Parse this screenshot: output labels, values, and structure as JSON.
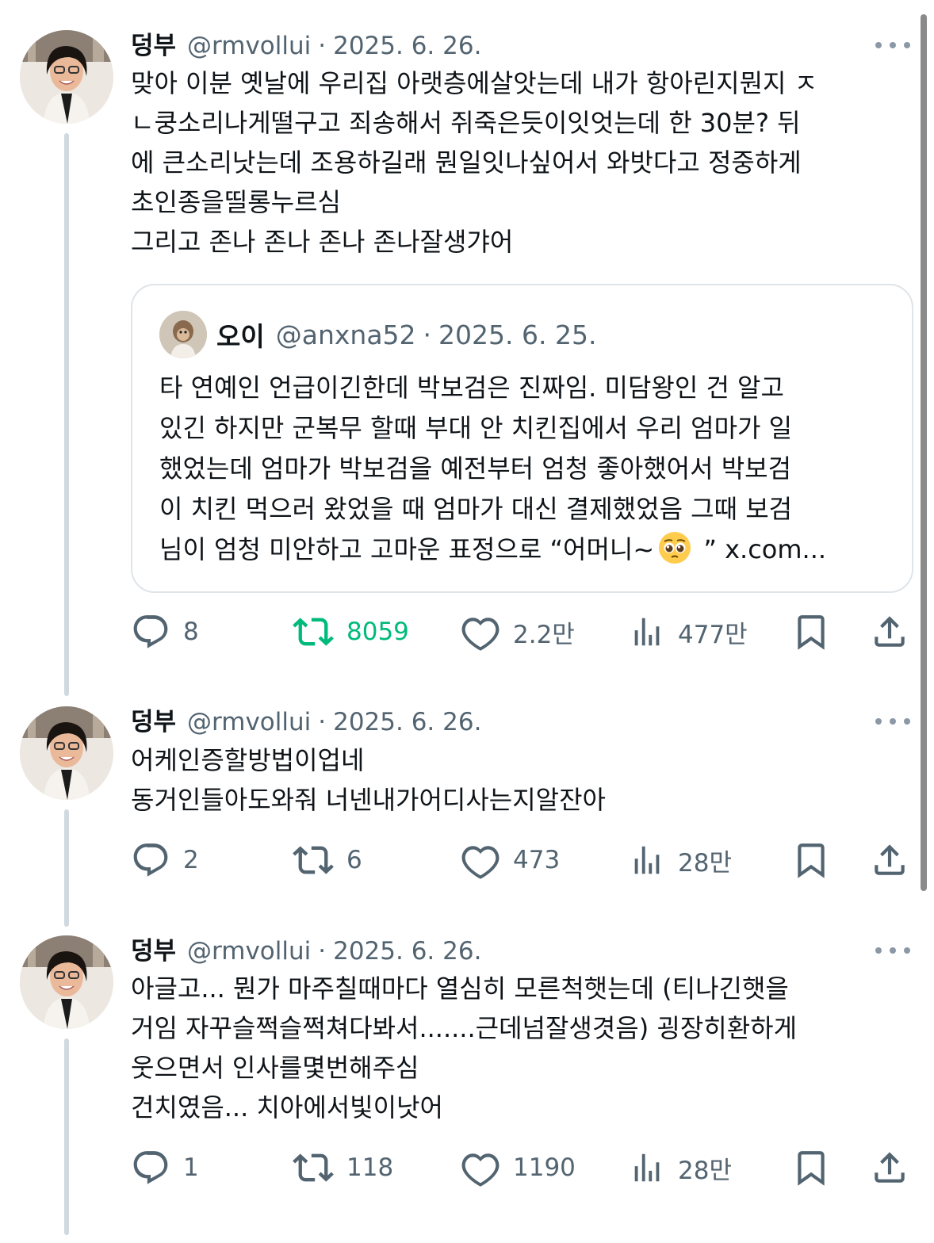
{
  "scrollbar": {
    "color": "#8a8a8a"
  },
  "colors": {
    "retweet_active": "#00ba7c",
    "muted": "#536471",
    "text": "#0f1419"
  },
  "tweets": [
    {
      "name": "덩부",
      "handle": "@rmvollui",
      "separator": "·",
      "date": "2025. 6. 26.",
      "more_icon": "more-dots-icon",
      "lines": [
        "맞아 이분 옛날에 우리집 아랫층에살앗는데 내가 항아린지뭔지 ㅈ",
        "ㄴ쿵소리나게떨구고 죄송해서 쥐죽은듯이잇엇는데 한 30분? 뒤",
        "에 큰소리낫는데 조용하길래 뭔일잇나싶어서 와밧다고 정중하게",
        "초인종을띨롱누르심",
        "그리고 존나 존나 존나 존나잘생갸어"
      ],
      "quote": {
        "name": "오이",
        "handle": "@anxna52",
        "separator": "·",
        "date": "2025. 6. 25.",
        "lines": [
          "타 연예인 언급이긴한데 박보검은 진짜임. 미담왕인 건 알고",
          "있긴 하지만 군복무 할때 부대 안 치킨집에서 우리 엄마가 일",
          "했었는데 엄마가 박보검을 예전부터 엄청 좋아했어서 박보검",
          "이 치킨 먹으러 왔었을 때 엄마가 대신 결제했었음 그때 보검"
        ],
        "last_line_pre": "님이 엄청 미안하고 고마운 표정으로 “어머니~",
        "last_line_emoji": "pleading-face-emoji",
        "last_line_post": " ” x.com..."
      },
      "replies": "8",
      "retweets": "8059",
      "likes": "2.2만",
      "views": "477만"
    },
    {
      "name": "덩부",
      "handle": "@rmvollui",
      "separator": "·",
      "date": "2025. 6. 26.",
      "lines": [
        "어케인증할방법이업네",
        "동거인들아도와줘 너넨내가어디사는지알잔아"
      ],
      "replies": "2",
      "retweets": "6",
      "likes": "473",
      "views": "28만"
    },
    {
      "name": "덩부",
      "handle": "@rmvollui",
      "separator": "·",
      "date": "2025. 6. 26.",
      "lines": [
        "아글고... 뭔가 마주칠때마다 열심히 모른척햇는데 (티나긴햇을",
        "거임 자꾸슬쩍슬쩍쳐다봐서.......근데넘잘생겻음) 굉장히환하게",
        "웃으면서 인사를몇번해주심",
        "건치였음... 치아에서빛이낫어"
      ],
      "replies": "1",
      "retweets": "118",
      "likes": "1190",
      "views": "28만"
    }
  ]
}
